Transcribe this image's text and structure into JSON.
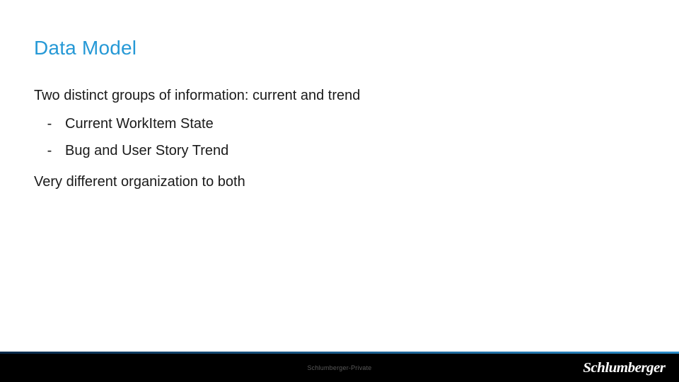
{
  "title": "Data Model",
  "intro": "Two distinct groups of information: current and trend",
  "bullets": [
    "Current WorkItem State",
    "Bug and User Story Trend"
  ],
  "closing": "Very different organization to both",
  "footer_center": "Schlumberger-Private",
  "brand": "Schlumberger"
}
